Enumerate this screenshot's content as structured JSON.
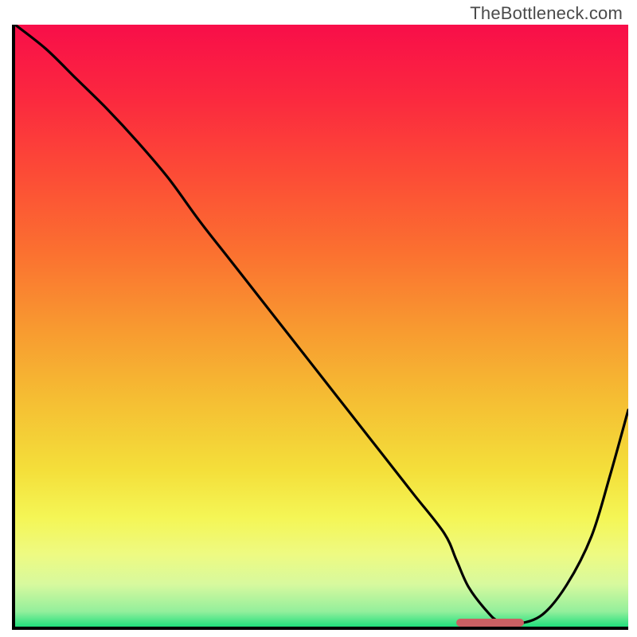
{
  "watermark": {
    "text": "TheBottleneck.com"
  },
  "chart_data": {
    "type": "line",
    "title": "",
    "xlabel": "",
    "ylabel": "",
    "x": [
      0.0,
      0.05,
      0.1,
      0.15,
      0.2,
      0.25,
      0.3,
      0.35,
      0.4,
      0.45,
      0.5,
      0.55,
      0.6,
      0.65,
      0.7,
      0.72,
      0.74,
      0.77,
      0.79,
      0.82,
      0.86,
      0.9,
      0.94,
      0.97,
      1.0
    ],
    "values": [
      1.0,
      0.96,
      0.91,
      0.86,
      0.805,
      0.745,
      0.675,
      0.61,
      0.545,
      0.48,
      0.415,
      0.35,
      0.285,
      0.22,
      0.155,
      0.11,
      0.065,
      0.025,
      0.008,
      0.005,
      0.02,
      0.07,
      0.15,
      0.25,
      0.36
    ],
    "xlim": [
      0,
      1
    ],
    "ylim": [
      0,
      1
    ],
    "gradient_stops": [
      {
        "offset": 0.0,
        "color": "#f80e49"
      },
      {
        "offset": 0.12,
        "color": "#fb283f"
      },
      {
        "offset": 0.25,
        "color": "#fc4c36"
      },
      {
        "offset": 0.38,
        "color": "#fb7130"
      },
      {
        "offset": 0.5,
        "color": "#f89830"
      },
      {
        "offset": 0.62,
        "color": "#f5bd33"
      },
      {
        "offset": 0.74,
        "color": "#f4df3a"
      },
      {
        "offset": 0.82,
        "color": "#f4f656"
      },
      {
        "offset": 0.88,
        "color": "#eefa82"
      },
      {
        "offset": 0.93,
        "color": "#d7f99e"
      },
      {
        "offset": 0.975,
        "color": "#93ef9c"
      },
      {
        "offset": 1.0,
        "color": "#21df7d"
      }
    ],
    "optimal_marker": {
      "x_start": 0.72,
      "x_end": 0.83,
      "y": 0.007,
      "color": "#cb6063"
    }
  }
}
